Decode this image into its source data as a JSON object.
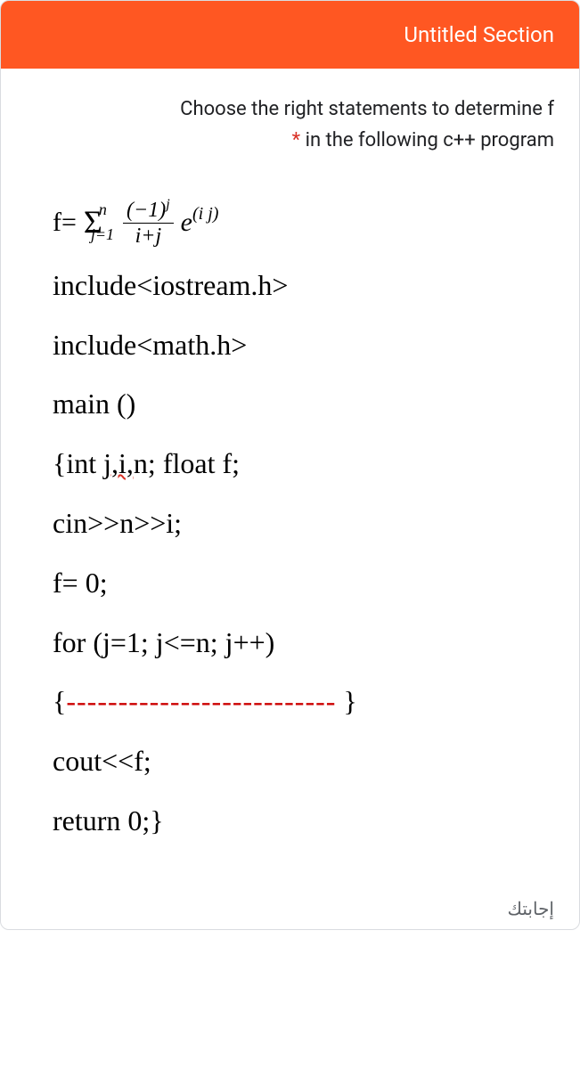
{
  "header": {
    "title": "Untitled Section"
  },
  "question": {
    "line1": "Choose the right statements to determine f",
    "line2": "in the following c++ program",
    "required_marker": "*"
  },
  "formula": {
    "lhs": "f=",
    "sigma_symbol": "Σ",
    "sigma_upper": "n",
    "sigma_lower": "j=1",
    "frac_num_base": "(−1)",
    "frac_num_exp": "j",
    "frac_den": "i+j",
    "e_base": "e",
    "e_exp": "(i j)"
  },
  "code": {
    "l1": "include<iostream.h>",
    "l2": "include<math.h>",
    "l3": "main ()",
    "l4a": "{int ",
    "l4b": "j,i,",
    "l4c": "n; float f;",
    "l5": "cin>>n>>i;",
    "l6": "f= 0;",
    "l7": "for (j=1; j<=n; j++)",
    "l8a": "{",
    "l8dash": "--------------------------",
    "l8b": " }",
    "l9": "cout<<f;",
    "l10": "return 0;}"
  },
  "answer_label": "إجابتك"
}
